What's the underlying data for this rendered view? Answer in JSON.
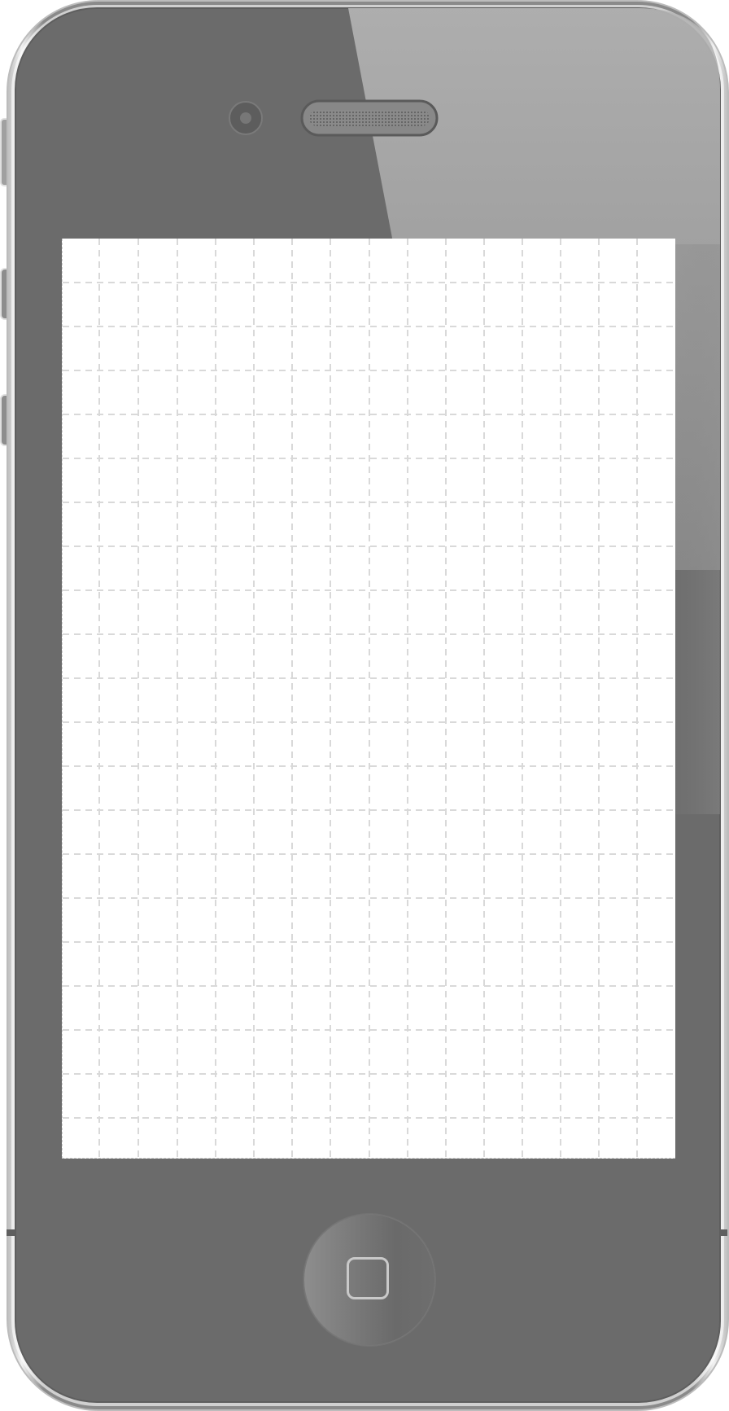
{
  "device": {
    "model": "phone",
    "body_color": "#6b6b6b",
    "frame_color": "#d9d9d9",
    "screen_color": "#ffffff",
    "grid_color": "#d6d6d6"
  },
  "icons": {
    "front_camera": "camera-icon",
    "earpiece": "speaker-grille-icon",
    "home": "home-button-icon",
    "side_buttons": "volume-buttons-icon"
  }
}
